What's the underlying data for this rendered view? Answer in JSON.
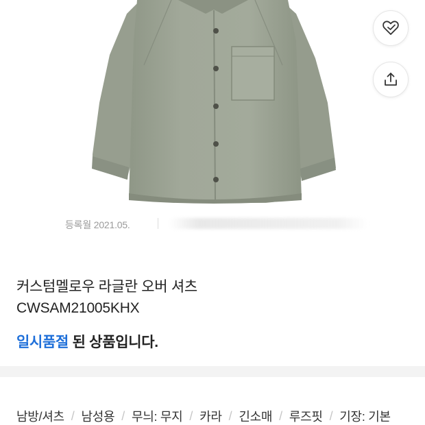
{
  "actions": {
    "like_icon": "heart-check-icon",
    "share_icon": "share-icon"
  },
  "registration": {
    "label": "등록월 2021.05."
  },
  "product": {
    "name": "커스텀멜로우 라글란 오버 셔츠",
    "code": "CWSAM21005KHX",
    "status_highlight": "일시품절",
    "status_rest": " 된 상품입니다."
  },
  "tags": [
    "남방/셔츠",
    "남성용",
    "무늬: 무지",
    "카라",
    "긴소매",
    "루즈핏",
    "기장: 기본"
  ],
  "colors": {
    "accent": "#1e6fd9",
    "shirt": "#9ea595",
    "divider_band": "#f3f3f3"
  }
}
